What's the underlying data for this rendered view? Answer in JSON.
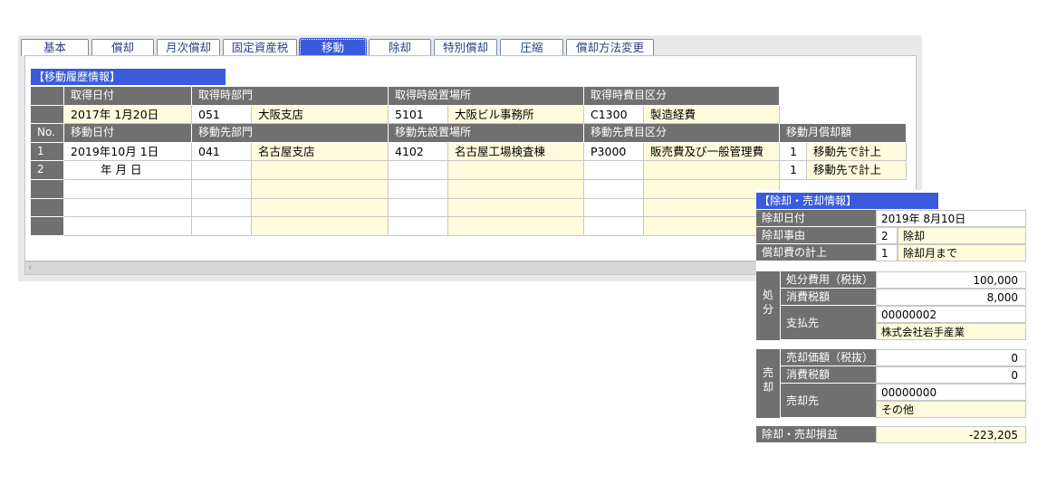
{
  "tabs": [
    "基本",
    "償却",
    "月次償却",
    "固定資産税",
    "移動",
    "除却",
    "特別償却",
    "圧縮",
    "償却方法変更"
  ],
  "active_tab": "移動",
  "transfer": {
    "section_title": "【移動履歴情報】",
    "acq_headers": [
      "取得日付",
      "取得時部門",
      "取得時設置場所",
      "取得時費目区分"
    ],
    "acq_row": {
      "date": "2017年  1月20日",
      "dept_code": "051",
      "dept_name": "大阪支店",
      "loc_code": "5101",
      "loc_name": "大阪ビル事務所",
      "exp_code": "C1300",
      "exp_name": "製造経費"
    },
    "move_headers": {
      "no": "No.",
      "date": "移動日付",
      "dept": "移動先部門",
      "loc": "移動先設置場所",
      "exp": "移動先費目区分",
      "depr": "移動月償却額"
    },
    "rows": [
      {
        "no": "1",
        "date": "2019年10月  1日",
        "dept_code": "041",
        "dept_name": "名古屋支店",
        "loc_code": "4102",
        "loc_name": "名古屋工場検査棟",
        "exp_code": "P3000",
        "exp_name": "販売費及び一般管理費",
        "depr_code": "1",
        "depr_name": "移動先で計上"
      },
      {
        "no": "2",
        "date": "年    月    日",
        "dept_code": "",
        "dept_name": "",
        "loc_code": "",
        "loc_name": "",
        "exp_code": "",
        "exp_name": "",
        "depr_code": "1",
        "depr_name": "移動先で計上"
      },
      {
        "no": "",
        "date": "",
        "dept_code": "",
        "dept_name": "",
        "loc_code": "",
        "loc_name": "",
        "exp_code": "",
        "exp_name": "",
        "depr_code": "",
        "depr_name": ""
      },
      {
        "no": "",
        "date": "",
        "dept_code": "",
        "dept_name": "",
        "loc_code": "",
        "loc_name": "",
        "exp_code": "",
        "exp_name": "",
        "depr_code": "",
        "depr_name": ""
      },
      {
        "no": "",
        "date": "",
        "dept_code": "",
        "dept_name": "",
        "loc_code": "",
        "loc_name": "",
        "exp_code": "",
        "exp_name": "",
        "depr_code": "",
        "depr_name": ""
      }
    ]
  },
  "disposal": {
    "section_title": "【除却・売却情報】",
    "date_label": "除却日付",
    "date_value": "2019年  8月10日",
    "reason_label": "除却事由",
    "reason_code": "2",
    "reason_name": "除却",
    "depr_label": "償却費の計上",
    "depr_code": "1",
    "depr_name": "除却月まで",
    "disp_group": "処\n分",
    "disp_cost_label": "処分費用（税抜）",
    "disp_cost_value": "100,000",
    "disp_tax_label": "消費税額",
    "disp_tax_value": "8,000",
    "payee_label": "支払先",
    "payee_code": "00000002",
    "payee_name": "株式会社岩手産業",
    "sale_group": "売\n却",
    "sale_price_label": "売却価額（税抜）",
    "sale_price_value": "0",
    "sale_tax_label": "消費税額",
    "sale_tax_value": "0",
    "buyer_label": "売却先",
    "buyer_code": "00000000",
    "buyer_name": "その他",
    "gain_label": "除却・売却損益",
    "gain_value": "-223,205"
  },
  "colors": {
    "accent": "#3a5bdb",
    "header": "#707070",
    "input_bg": "#fffbdc"
  }
}
